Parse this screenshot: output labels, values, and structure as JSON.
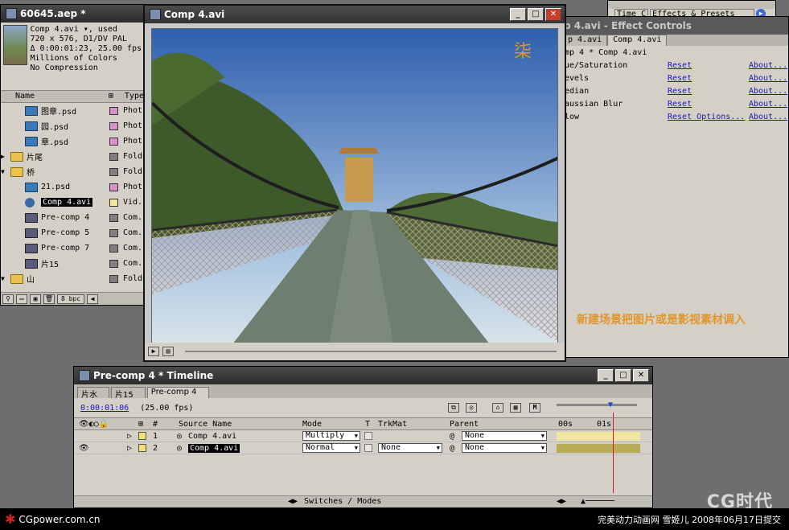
{
  "project": {
    "title": "60645.aep *",
    "meta": [
      "Comp 4.avi ▾, used",
      "720 x 576, D1/DV PAL",
      "Δ 0:00:01:23, 25.00 fps",
      "Millions of Colors",
      "No Compression"
    ],
    "col_name": "Name",
    "col_type": "Type",
    "items": [
      {
        "name": "图章.psd",
        "type": "Phot",
        "swatch": "#d890c8",
        "icon": "psd",
        "indent": 30
      },
      {
        "name": "园.psd",
        "type": "Phot",
        "swatch": "#d890c8",
        "icon": "psd",
        "indent": 30
      },
      {
        "name": "章.psd",
        "type": "Phot",
        "swatch": "#d890c8",
        "icon": "psd",
        "indent": 30
      },
      {
        "name": "片尾",
        "type": "Fold",
        "swatch": "#808080",
        "icon": "folder",
        "indent": 12
      },
      {
        "name": "桥",
        "type": "Fold",
        "swatch": "#808080",
        "icon": "folder",
        "indent": 12
      },
      {
        "name": "21.psd",
        "type": "Phot",
        "swatch": "#d890c8",
        "icon": "psd",
        "indent": 30
      },
      {
        "name": "Comp 4.avi",
        "type": "Vid.",
        "swatch": "#f0e6a0",
        "icon": "vid",
        "indent": 30,
        "selected": true
      },
      {
        "name": "Pre-comp 4",
        "type": "Com.",
        "swatch": "#808080",
        "icon": "comp",
        "indent": 30
      },
      {
        "name": "Pre-comp 5",
        "type": "Com.",
        "swatch": "#808080",
        "icon": "comp",
        "indent": 30
      },
      {
        "name": "Pre-comp 7",
        "type": "Com.",
        "swatch": "#808080",
        "icon": "comp",
        "indent": 30
      },
      {
        "name": "片15",
        "type": "Com.",
        "swatch": "#808080",
        "icon": "comp",
        "indent": 30
      },
      {
        "name": "山",
        "type": "Fold",
        "swatch": "#808080",
        "icon": "folder",
        "indent": 12
      }
    ],
    "bpc": "8 bpc"
  },
  "info_panel": {
    "tabs": [
      "Time C",
      "Effects & Presets"
    ]
  },
  "effects": {
    "title": "p 4.avi - Effect Controls",
    "tabs": [
      "p 4.avi",
      "Comp 4.avi"
    ],
    "subtitle": "mp 4 * Comp 4.avi",
    "rows": [
      {
        "name": "ue/Saturation",
        "reset": "Reset",
        "about": "About..."
      },
      {
        "name": "evels",
        "reset": "Reset",
        "about": "About..."
      },
      {
        "name": "edian",
        "reset": "Reset",
        "about": "About..."
      },
      {
        "name": "aussian Blur",
        "reset": "Reset",
        "about": "About..."
      },
      {
        "name": "low",
        "reset": "Reset Options...",
        "about": "About..."
      }
    ],
    "caption": "新建场景把图片或是影视素材调入"
  },
  "viewer": {
    "title": "Comp 4.avi"
  },
  "timeline": {
    "title": "Pre-comp 4 * Timeline",
    "tabs": [
      "片水",
      "片15",
      "Pre-comp 4"
    ],
    "timecode": "0:00:01:06",
    "fps": "(25.00 fps)",
    "headers": {
      "num": "#",
      "source": "Source Name",
      "mode": "Mode",
      "t": "T",
      "trkmat": "TrkMat",
      "parent": "Parent"
    },
    "ruler": [
      "00s",
      "01s"
    ],
    "layers": [
      {
        "num": "1",
        "name": "Comp 4.avi",
        "mode": "Multiply",
        "trkmat": "",
        "parent": "None"
      },
      {
        "num": "2",
        "name": "Comp 4.avi",
        "mode": "Normal",
        "trkmat": "None",
        "parent": "None"
      }
    ],
    "footer": "Switches / Modes"
  },
  "status": {
    "site": "CGpower.com.cn",
    "credit": "完美动力动画网 雪姬儿 2008年06月17日提交",
    "watermark": "CG时代"
  }
}
